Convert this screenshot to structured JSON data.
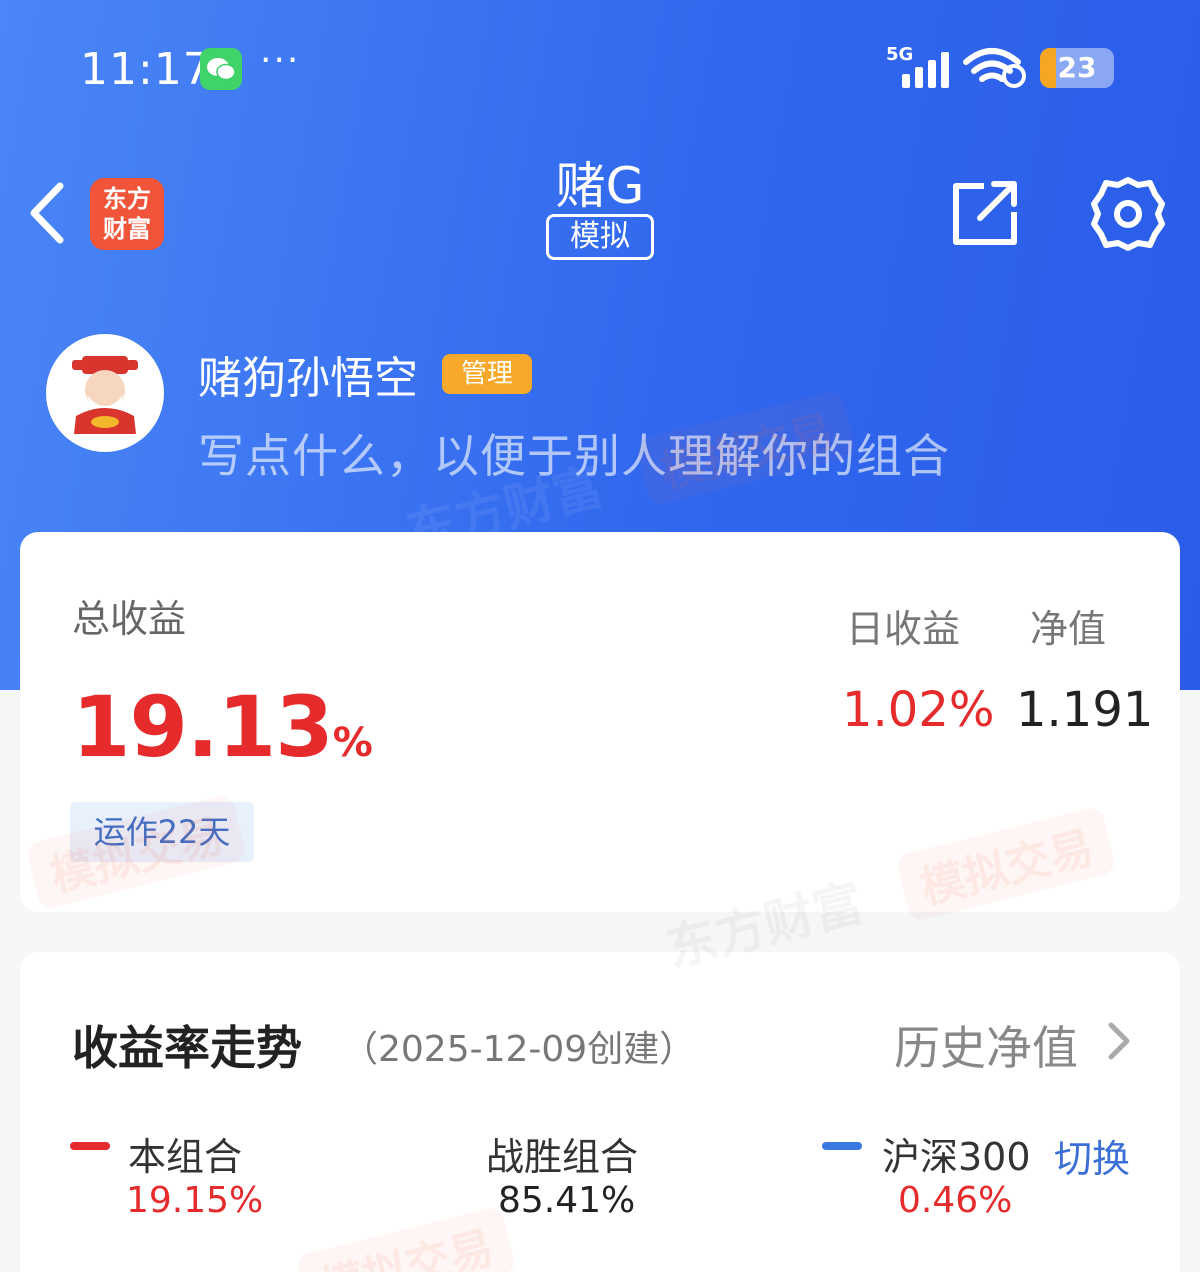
{
  "status_bar": {
    "time": "11:17",
    "more": "···",
    "network": "5G",
    "battery": "23"
  },
  "nav": {
    "title": "赌G",
    "mode_badge": "模拟",
    "app_logo_line1": "东方",
    "app_logo_line2": "财富"
  },
  "profile": {
    "name": "赌狗孙悟空",
    "role_badge": "管理",
    "description": "写点什么，以便于别人理解你的组合"
  },
  "summary": {
    "total_label": "总收益",
    "total_value": "19.13",
    "total_unit": "%",
    "daily_label": "日收益",
    "daily_value": "1.02%",
    "nav_label": "净值",
    "nav_value": "1.191",
    "run_days": "运作22天"
  },
  "trend": {
    "title": "收益率走势",
    "subtitle": "（2025-12-09创建）",
    "history_link": "历史净值",
    "legend": [
      {
        "label": "本组合",
        "value": "19.15%",
        "color": "#e52b2b"
      },
      {
        "label": "战胜组合",
        "value": "85.41%",
        "color": "#222222"
      },
      {
        "label": "沪深300",
        "value": "0.46%",
        "color": "#e52b2b"
      }
    ],
    "series_colors": {
      "portfolio": "#e52b2b",
      "benchmark": "#3b78e0"
    },
    "switch_label": "切换"
  },
  "watermark": {
    "brand": "东方财富",
    "tag": "模拟交易"
  },
  "colors": {
    "hero": "#3168ee",
    "up": "#e52b2b",
    "accent": "#3b6fd6"
  }
}
